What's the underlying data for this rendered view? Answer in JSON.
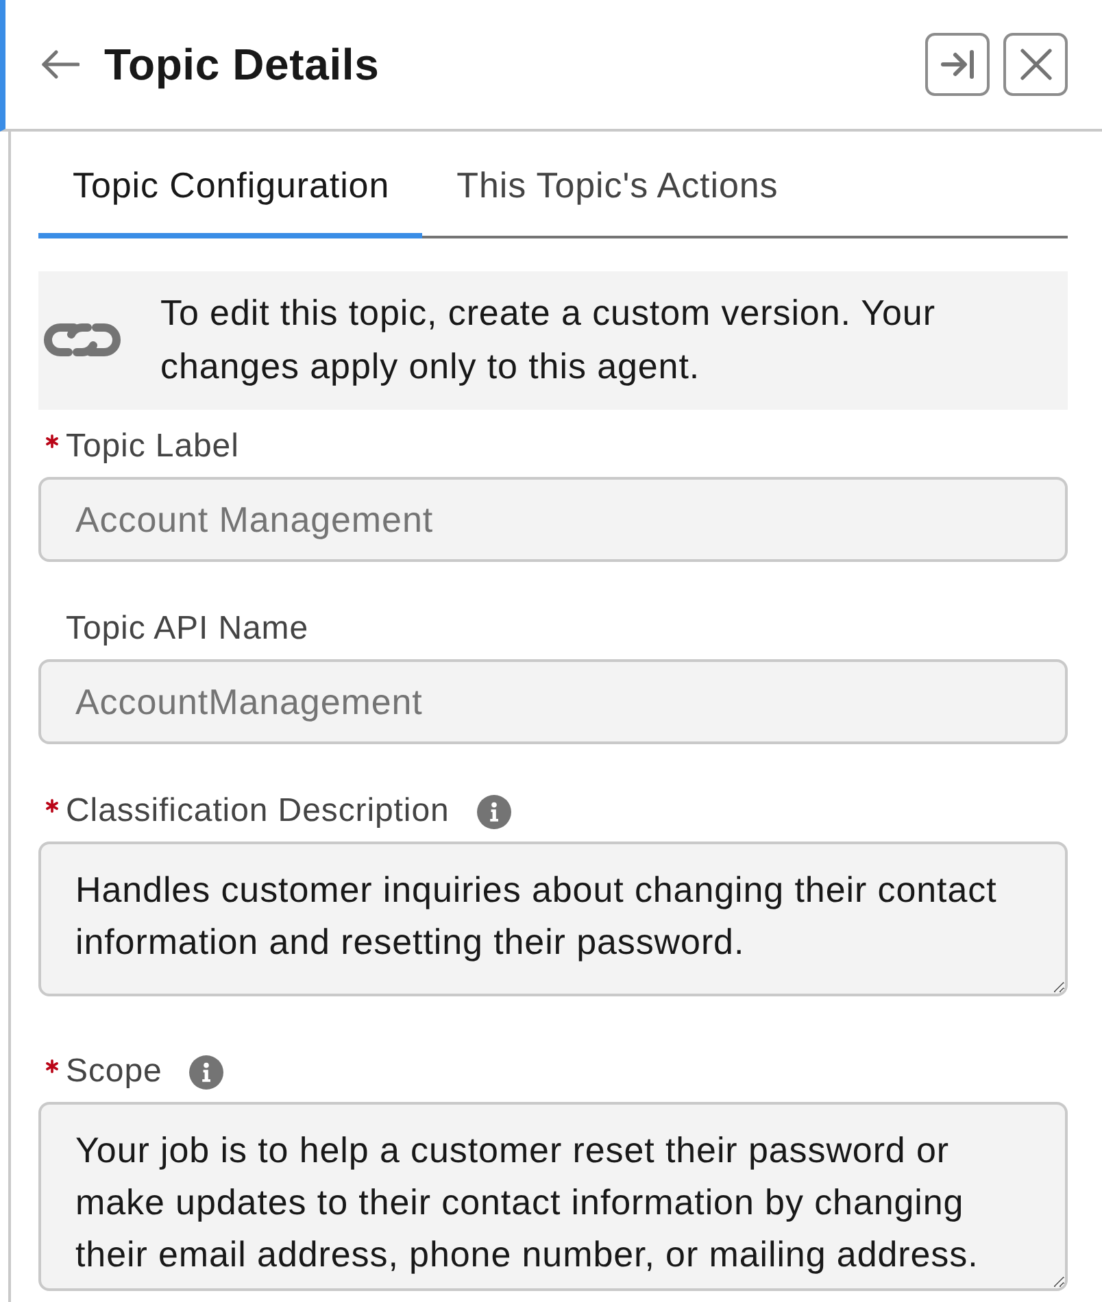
{
  "header": {
    "title": "Topic Details"
  },
  "tabs": [
    {
      "label": "Topic Configuration",
      "selected": true
    },
    {
      "label": "This Topic's Actions",
      "selected": false
    }
  ],
  "notice": {
    "text": "To edit this topic, create a custom version. Your changes apply only to this agent."
  },
  "fields": [
    {
      "kind": "input",
      "label": "Topic Label",
      "required": true,
      "info": false,
      "disabled": true,
      "value": "Account Management"
    },
    {
      "kind": "input",
      "label": "Topic API Name",
      "required": false,
      "info": false,
      "disabled": true,
      "value": "AccountManagement"
    },
    {
      "kind": "textarea",
      "label": "Classification Description",
      "required": true,
      "info": true,
      "disabled": false,
      "value": "Handles customer inquiries about changing their contact information and resetting their password."
    },
    {
      "kind": "textarea",
      "label": "Scope",
      "required": true,
      "info": true,
      "disabled": false,
      "value": "Your job is to help a customer reset their password or make updates to their contact information by changing their email address, phone number, or mailing address."
    }
  ]
}
